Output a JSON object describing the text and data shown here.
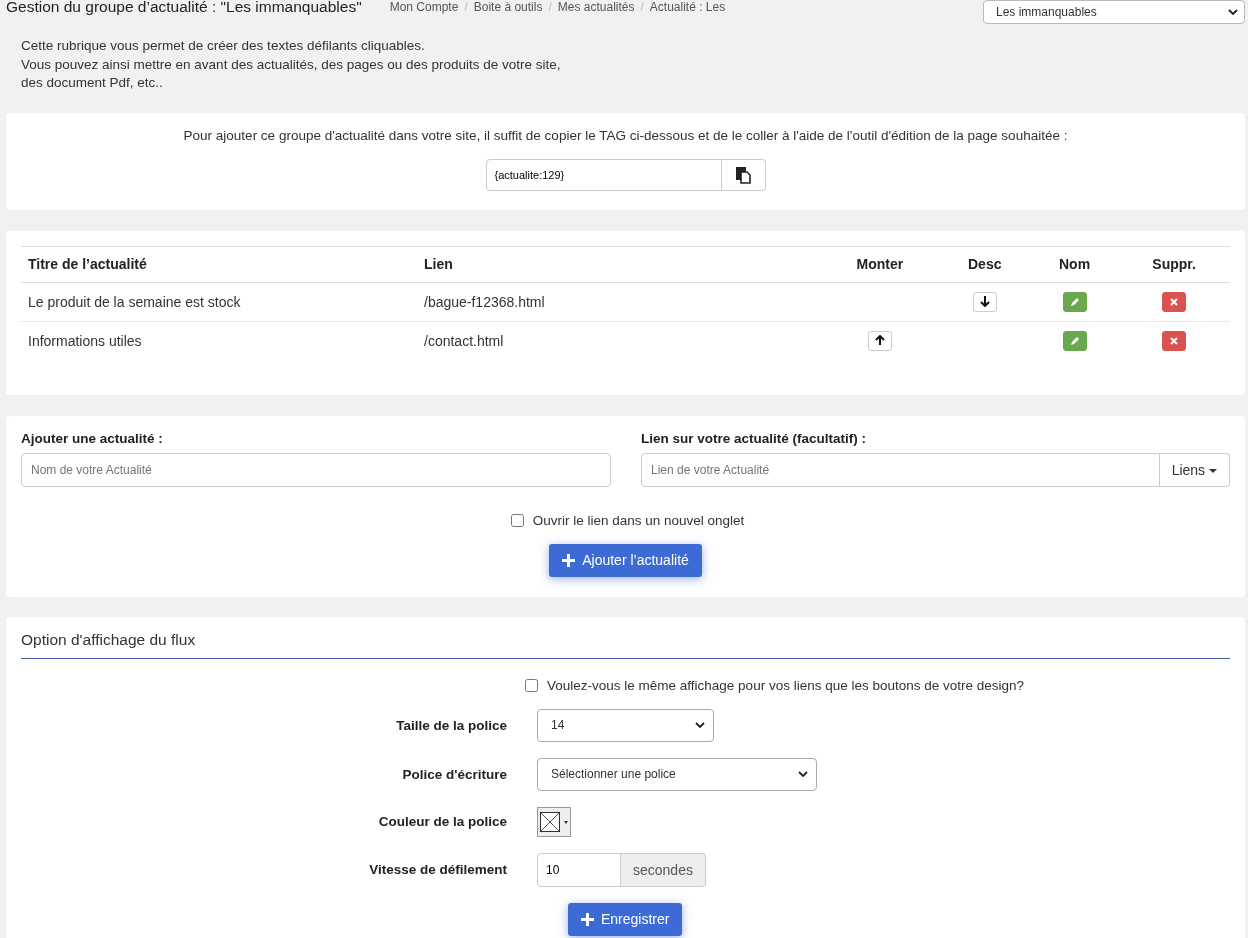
{
  "header": {
    "title": "Gestion du groupe d’actualité : \"Les immanquables\"",
    "breadcrumbs": [
      "Mon Compte",
      "Boite à outils",
      "Mes actualités",
      "Actualité : Les"
    ],
    "breadcrumb_separators": [
      "/",
      "/",
      "/"
    ],
    "group_select": "Les immanquables"
  },
  "intro": [
    "Cette rubrique vous permet de créer des textes défilants cliquables.",
    "Vous pouvez ainsi mettre en avant des actualités, des pages ou des produits de votre site,",
    "des document Pdf, etc.."
  ],
  "tag_card": {
    "text": "Pour ajouter ce groupe d'actualité dans votre site, il suffit de copier le TAG ci-dessous et de le coller à l'aide de l'outil d'édition de la page souhaitée :",
    "tag": "{actualite:129}"
  },
  "table": {
    "columns": [
      "Titre de l’actualité",
      "Lien",
      "Monter",
      "Desc",
      "Nom",
      "Suppr."
    ],
    "rows": [
      {
        "title": "Le produit de la semaine est stock",
        "link": "/bague-f12368.html",
        "can_move_up": false,
        "can_move_down": true
      },
      {
        "title": "Informations utiles",
        "link": "/contact.html",
        "can_move_up": true,
        "can_move_down": false
      }
    ]
  },
  "add_form": {
    "name_label": "Ajouter une actualité :",
    "name_placeholder": "Nom de votre Actualité",
    "link_label": "Lien sur votre actualité (facultatif) :",
    "link_placeholder": "Lien de votre Actualité",
    "links_button": "Liens",
    "new_tab": {
      "label": "Ouvrir le lien dans un nouvel onglet",
      "checked": false
    },
    "submit": "Ajouter l’actualité"
  },
  "options": {
    "title": "Option d'affichage du flux",
    "same_display": {
      "label": "Voulez-vous le même affichage pour vos liens que les boutons de votre design?",
      "checked": false
    },
    "font_size_label": "Taille de la police",
    "font_size": "14",
    "font_label": "Police d'écriture",
    "font": "Sélectionner une police",
    "color_label": "Couleur de la police",
    "speed_label": "Vitesse de défilement",
    "speed": "10",
    "speed_unit": "secondes",
    "save": "Enregistrer"
  }
}
